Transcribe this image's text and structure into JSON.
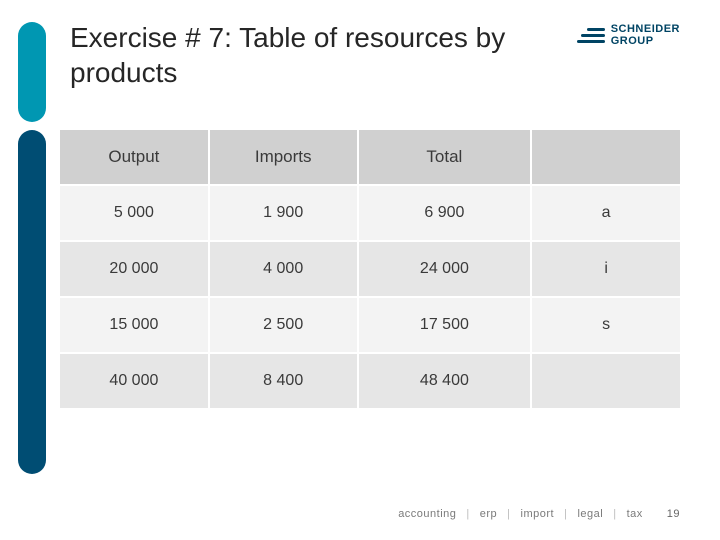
{
  "title": "Exercise # 7: Table of resources by products",
  "logo": {
    "line1": "SCHNEIDER",
    "line2": "GROUP"
  },
  "chart_data": {
    "type": "table",
    "title": "Table of resources by products",
    "headers": [
      "Output",
      "Imports",
      "Total",
      ""
    ],
    "rows": [
      {
        "output": "5 000",
        "imports": "1 900",
        "total": "6 900",
        "tag": "a"
      },
      {
        "output": "20 000",
        "imports": "4 000",
        "total": "24 000",
        "tag": "i"
      },
      {
        "output": "15 000",
        "imports": "2 500",
        "total": "17 500",
        "tag": "s"
      },
      {
        "output": "40 000",
        "imports": "8 400",
        "total": "48 400",
        "tag": ""
      }
    ]
  },
  "footer": {
    "items": [
      "accounting",
      "erp",
      "import",
      "legal",
      "tax"
    ]
  },
  "page_number": "19"
}
